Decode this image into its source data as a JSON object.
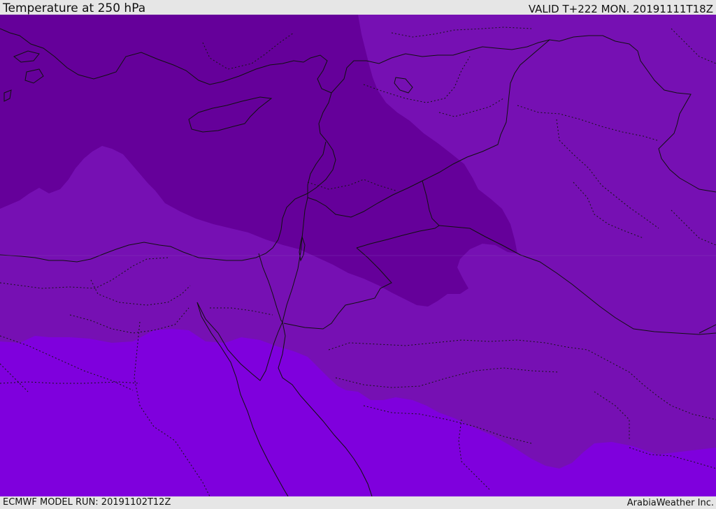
{
  "header": {
    "title": "Temperature at 250 hPa",
    "valid": "VALID T+222 MON. 20191111T18Z"
  },
  "footer": {
    "model_run": "ECMWF MODEL RUN: 20191102T12Z",
    "credit": "ArabiaWeather Inc."
  },
  "map": {
    "colors": {
      "coldest_band": "#65009a",
      "mid_band": "#7610b3",
      "warmest_band": "#7f00dd",
      "coastline": "#101010",
      "border": "#101010"
    },
    "layers": [
      "temperature-bands",
      "coastlines",
      "country-borders",
      "provincial-borders"
    ]
  }
}
